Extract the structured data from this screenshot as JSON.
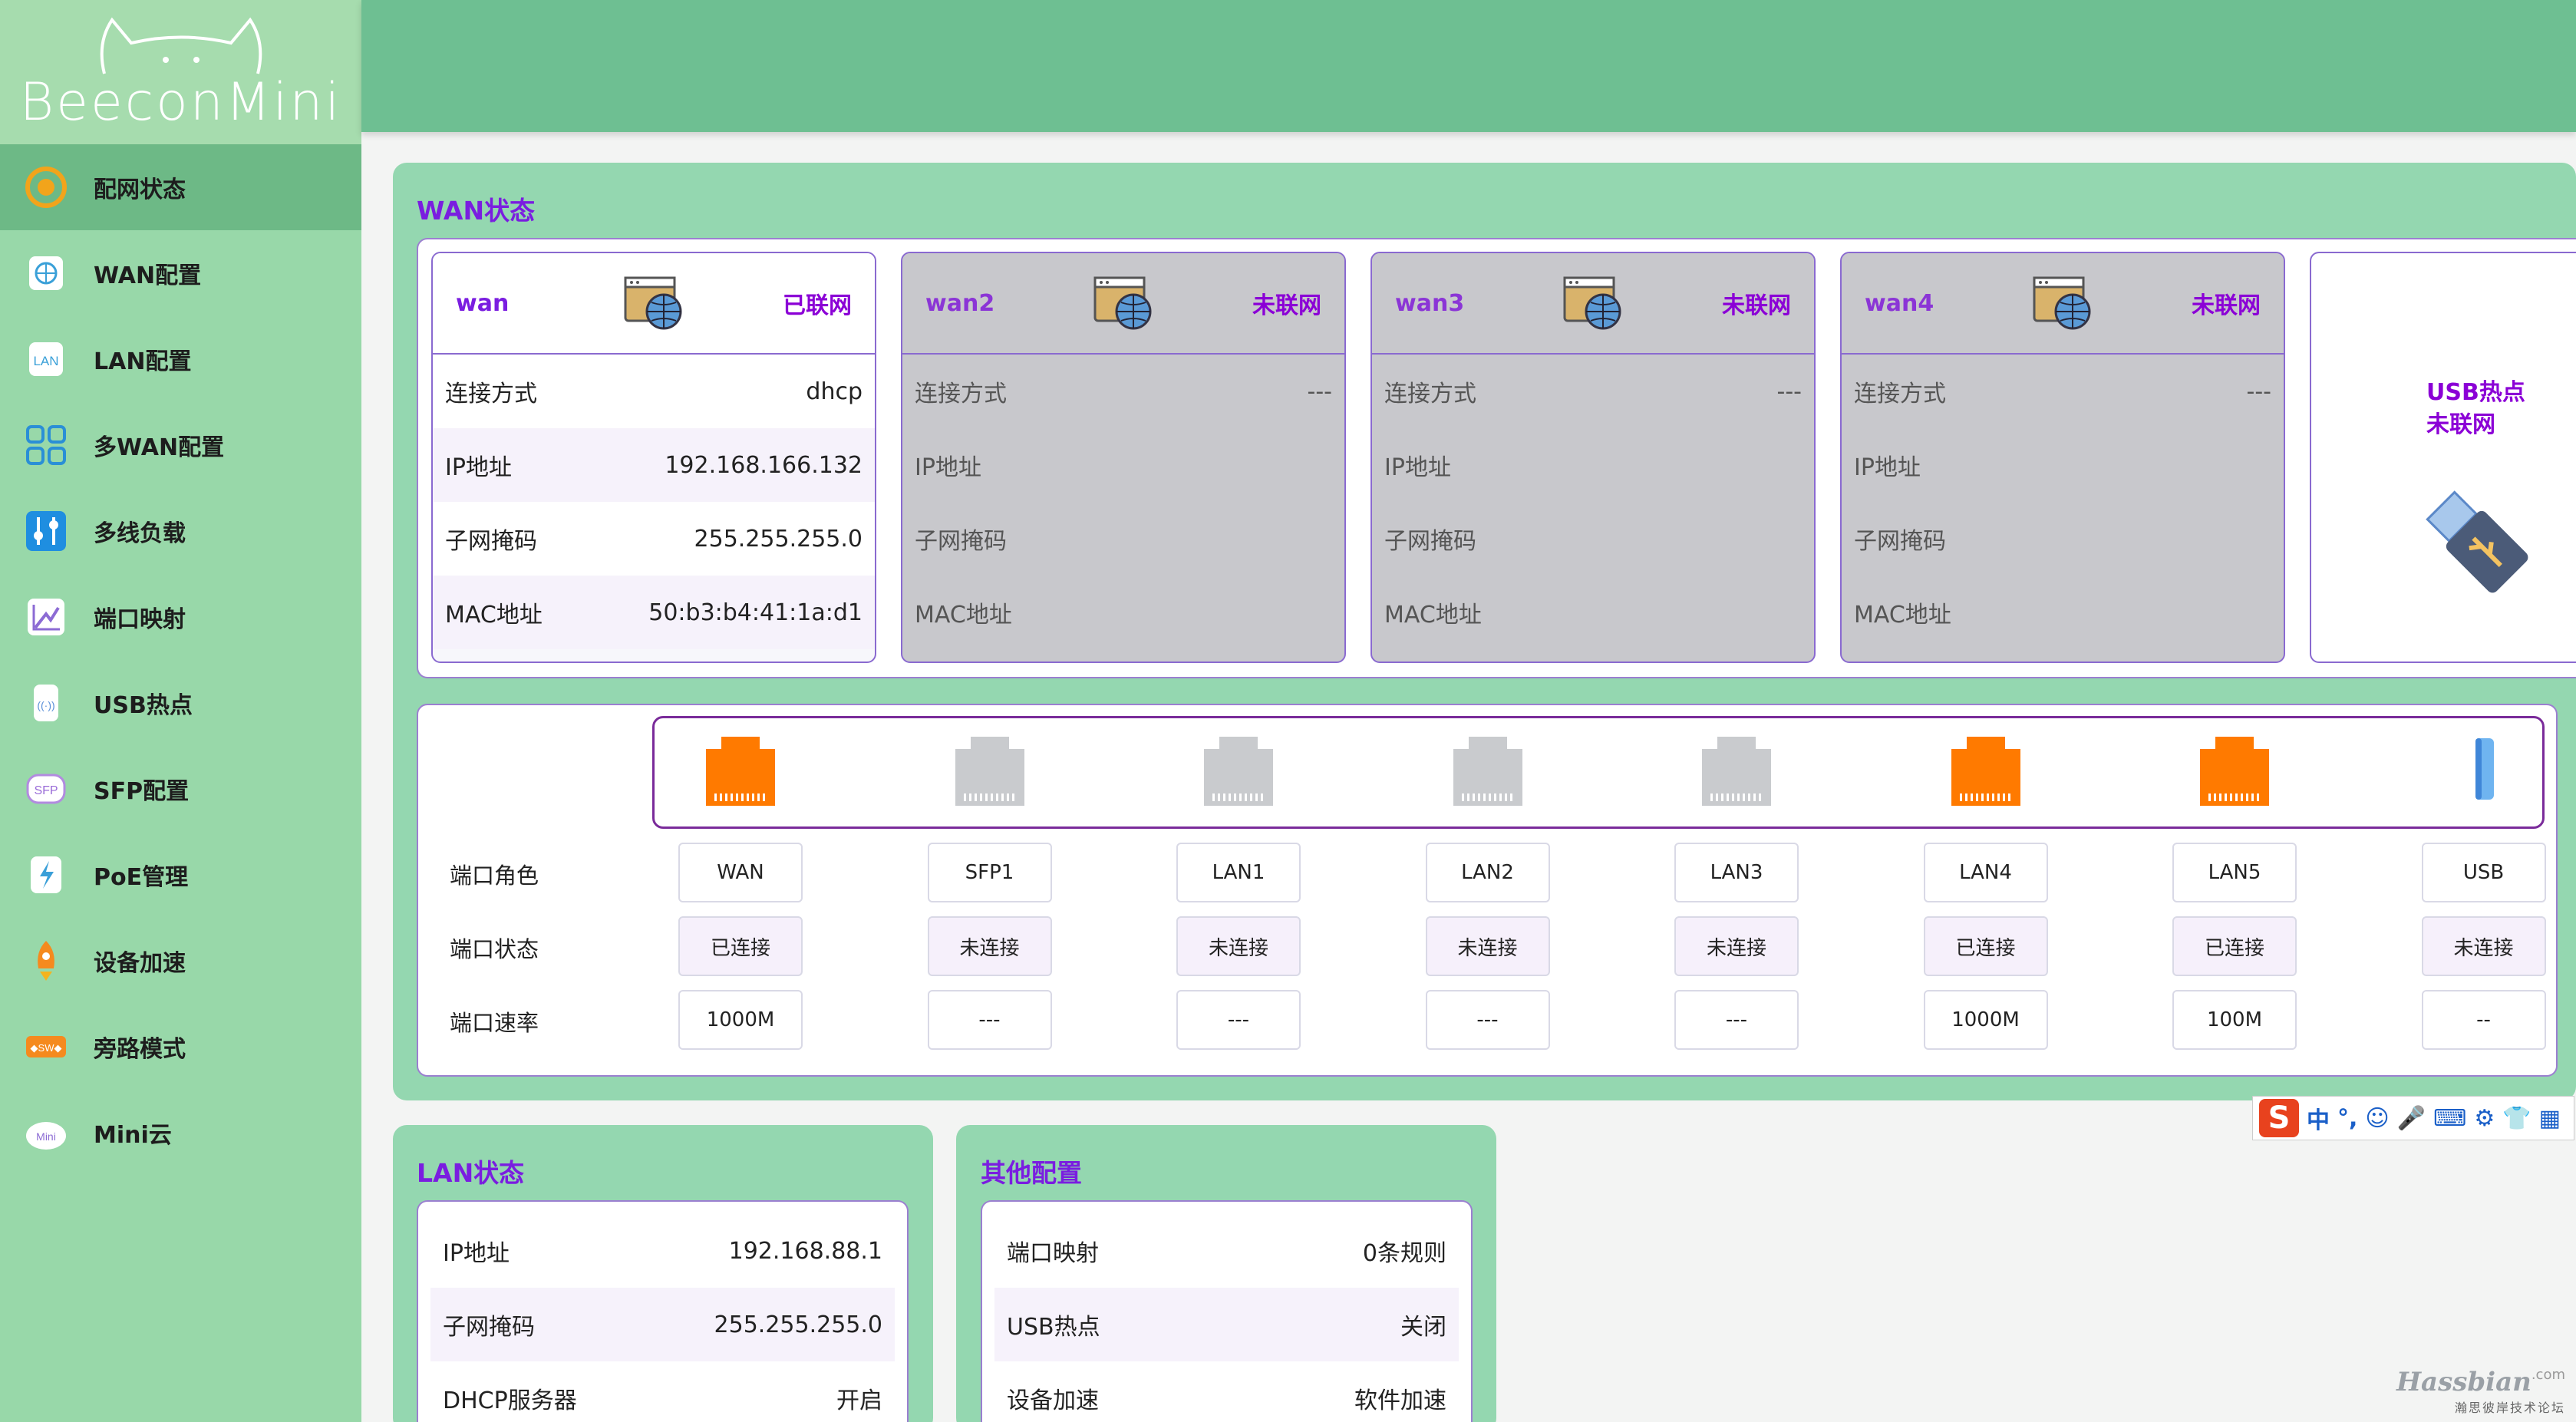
{
  "brand": {
    "name": "BeeconMini"
  },
  "sidebar": {
    "items": [
      {
        "label": "配网状态",
        "icon": "network-status-icon",
        "active": true
      },
      {
        "label": "WAN配置",
        "icon": "globe-icon"
      },
      {
        "label": "LAN配置",
        "icon": "lan-icon"
      },
      {
        "label": "多WAN配置",
        "icon": "grid-icon"
      },
      {
        "label": "多线负载",
        "icon": "sliders-icon"
      },
      {
        "label": "端口映射",
        "icon": "chart-icon"
      },
      {
        "label": "USB热点",
        "icon": "usb-hotspot-icon"
      },
      {
        "label": "SFP配置",
        "icon": "sfp-icon"
      },
      {
        "label": "PoE管理",
        "icon": "poe-icon"
      },
      {
        "label": "设备加速",
        "icon": "rocket-icon"
      },
      {
        "label": "旁路模式",
        "icon": "bypass-icon"
      },
      {
        "label": "Mini云",
        "icon": "cloud-icon"
      }
    ]
  },
  "wan_panel": {
    "title": "WAN状态",
    "row_labels": [
      "连接方式",
      "IP地址",
      "子网掩码",
      "MAC地址"
    ],
    "cards": [
      {
        "name": "wan",
        "status": "已联网",
        "online": true,
        "values": [
          "dhcp",
          "192.168.166.132",
          "255.255.255.0",
          "50:b3:b4:41:1a:d1"
        ]
      },
      {
        "name": "wan2",
        "status": "未联网",
        "online": false,
        "values": [
          "---",
          "",
          "",
          ""
        ]
      },
      {
        "name": "wan3",
        "status": "未联网",
        "online": false,
        "values": [
          "---",
          "",
          "",
          ""
        ]
      },
      {
        "name": "wan4",
        "status": "未联网",
        "online": false,
        "values": [
          "---",
          "",
          "",
          ""
        ]
      }
    ],
    "usb": {
      "title": "USB热点",
      "status": "未联网"
    }
  },
  "ports": {
    "row_labels": {
      "role": "端口角色",
      "status": "端口状态",
      "speed": "端口速率"
    },
    "items": [
      {
        "role": "WAN",
        "status": "已连接",
        "speed": "1000M",
        "connected": true,
        "kind": "rj45"
      },
      {
        "role": "SFP1",
        "status": "未连接",
        "speed": "---",
        "connected": false,
        "kind": "rj45"
      },
      {
        "role": "LAN1",
        "status": "未连接",
        "speed": "---",
        "connected": false,
        "kind": "rj45"
      },
      {
        "role": "LAN2",
        "status": "未连接",
        "speed": "---",
        "connected": false,
        "kind": "rj45"
      },
      {
        "role": "LAN3",
        "status": "未连接",
        "speed": "---",
        "connected": false,
        "kind": "rj45"
      },
      {
        "role": "LAN4",
        "status": "已连接",
        "speed": "1000M",
        "connected": true,
        "kind": "rj45"
      },
      {
        "role": "LAN5",
        "status": "已连接",
        "speed": "100M",
        "connected": true,
        "kind": "rj45"
      },
      {
        "role": "USB",
        "status": "未连接",
        "speed": "--",
        "connected": false,
        "kind": "usb"
      }
    ]
  },
  "lan_panel": {
    "title": "LAN状态",
    "rows": [
      {
        "label": "IP地址",
        "value": "192.168.88.1"
      },
      {
        "label": "子网掩码",
        "value": "255.255.255.0"
      },
      {
        "label": "DHCP服务器",
        "value": "开启"
      }
    ]
  },
  "other_panel": {
    "title": "其他配置",
    "rows": [
      {
        "label": "端口映射",
        "value": "0条规则"
      },
      {
        "label": "USB热点",
        "value": "关闭"
      },
      {
        "label": "设备加速",
        "value": "软件加速"
      }
    ]
  },
  "ime": {
    "logo": "S",
    "lang": "中",
    "punct": "°,"
  },
  "watermark": {
    "site": "Hassbian",
    "tld": ".com",
    "sub": "瀚思彼岸技术论坛"
  },
  "colors": {
    "accent": "#7a1de0",
    "header": "#6ebf92",
    "sidebar": "#98d8a9",
    "port_on": "#ff7a00",
    "port_off": "#c9cbce"
  }
}
